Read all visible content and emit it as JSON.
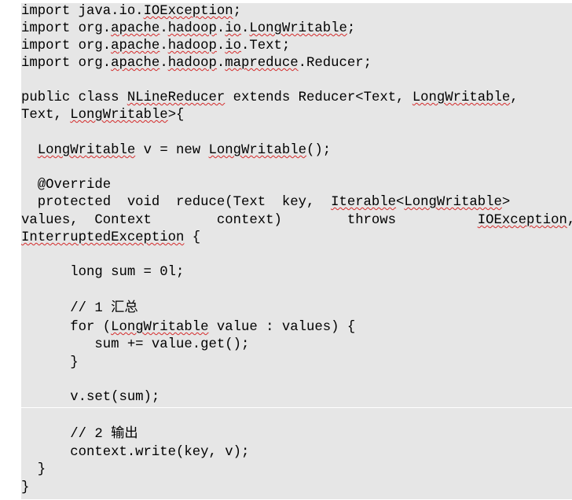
{
  "code": {
    "lines": {
      "l1": {
        "a": "import java.io.",
        "b": "IOException",
        "c": ";"
      },
      "l2": {
        "a": "import org.",
        "b": "apache",
        "c": ".",
        "d": "hadoop",
        "e": ".",
        "f": "io",
        "g": ".",
        "h": "LongWritable",
        "i": ";"
      },
      "l3": {
        "a": "import org.",
        "b": "apache",
        "c": ".",
        "d": "hadoop",
        "e": ".",
        "f": "io",
        "g": ".Text;"
      },
      "l4": {
        "a": "import org.",
        "b": "apache",
        "c": ".",
        "d": "hadoop",
        "e": ".",
        "f": "mapreduce",
        "g": ".Reducer;"
      },
      "l5": {
        "a": "public class ",
        "b": "NLineReducer",
        "c": " extends Reducer<Text, ",
        "d": "LongWritable",
        "e": ","
      },
      "l6": {
        "a": "Text, ",
        "b": "LongWritable",
        "c": ">{"
      },
      "l7": {
        "a": "  ",
        "b": "LongWritable",
        "c": " v = new ",
        "d": "LongWritable",
        "e": "();"
      },
      "l8": {
        "a": "  @Override"
      },
      "l9": {
        "a": "  protected  void  reduce(Text  key,  ",
        "b": "Iterable",
        "c": "<",
        "d": "LongWritable",
        "e": ">"
      },
      "l10": {
        "a": "values,  Context        context)        throws          ",
        "b": "IOException",
        "c": ","
      },
      "l11": {
        "a": "InterruptedException",
        "b": " {"
      },
      "l12": {
        "a": "      long sum = 0l;"
      },
      "l13": {
        "a": "      // 1 汇总"
      },
      "l14": {
        "a": "      for (",
        "b": "LongWritable",
        "c": " value : values) {"
      },
      "l15": {
        "a": "         sum += value.get();"
      },
      "l16": {
        "a": "      }"
      },
      "l17": {
        "a": "      v.set(sum);"
      },
      "l18": {
        "a": "      // 2 输出"
      },
      "l19": {
        "a": "      context.write(key, v);"
      },
      "l20": {
        "a": "  }"
      },
      "l21": {
        "a": "}"
      }
    }
  }
}
